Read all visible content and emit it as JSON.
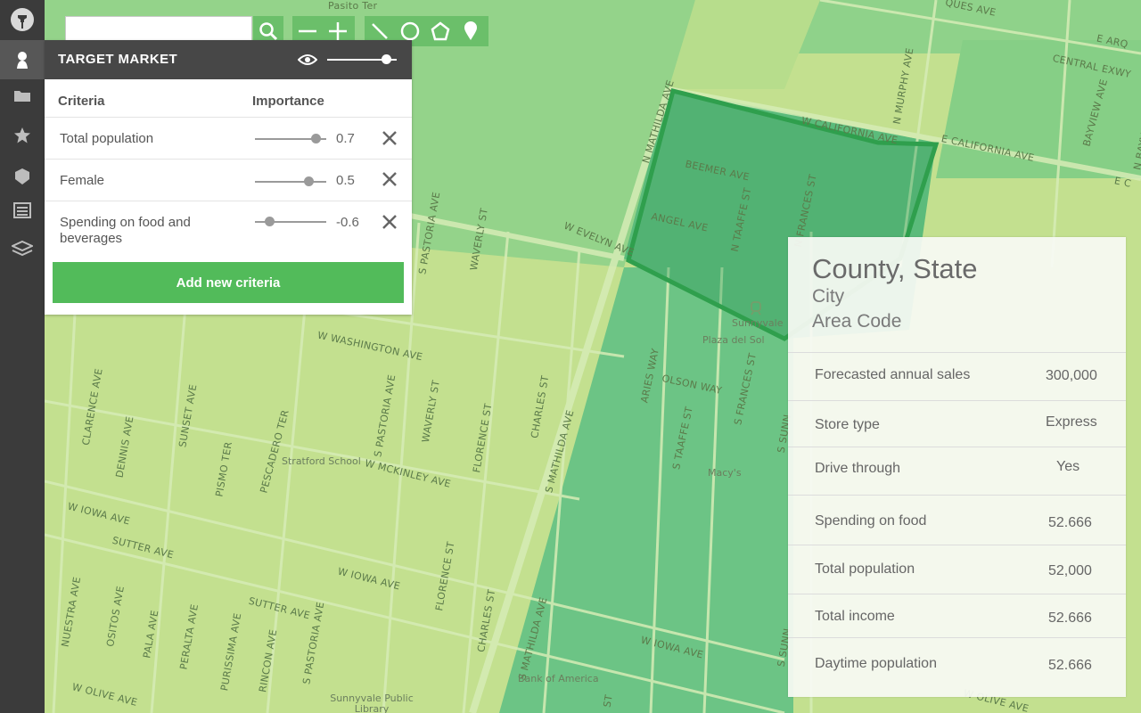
{
  "sidebar": {
    "items": [
      {
        "icon": "pin-icon"
      },
      {
        "icon": "user-icon"
      },
      {
        "icon": "folder-icon"
      },
      {
        "icon": "star-icon"
      },
      {
        "icon": "tag-icon"
      },
      {
        "icon": "list-icon"
      },
      {
        "icon": "layers-icon"
      }
    ]
  },
  "search": {
    "placeholder": ""
  },
  "toolbar": {
    "tools": [
      "search-icon",
      "minus-icon",
      "plus-icon",
      "line-icon",
      "circle-icon",
      "polygon-icon",
      "marker-icon"
    ]
  },
  "panel": {
    "title": "TARGET MARKET",
    "opacity_level": 0.85,
    "col_criteria": "Criteria",
    "col_importance": "Importance",
    "rows": [
      {
        "label": "Total population",
        "value": "0.7",
        "slider": 0.7
      },
      {
        "label": "Female",
        "value": "0.5",
        "slider": 0.5
      },
      {
        "label": "Spending on food and beverages",
        "value": "-0.6",
        "slider": -0.6
      }
    ],
    "add_label": "Add new criteria"
  },
  "card": {
    "title": "County, State",
    "city": "City",
    "area_code": "Area Code",
    "rows": [
      {
        "label": "Forecasted annual sales",
        "value": "300,000"
      },
      {
        "label": "Store type",
        "value": "Express"
      },
      {
        "label": "Drive through",
        "value": "Yes"
      },
      {
        "label": "Spending on food",
        "value": "52.666"
      },
      {
        "label": "Total population",
        "value": "52,000"
      },
      {
        "label": "Total income",
        "value": "52.666"
      },
      {
        "label": "Daytime population",
        "value": "52.666"
      }
    ]
  },
  "map": {
    "streets": [
      "Pasito Ter",
      "QUES AVE",
      "E ARQ",
      "CENTRAL EXWY",
      "N MURPHY AVE",
      "BAYVIEW AVE",
      "N BAYVIEW AVE",
      "W CALIFORNIA AVE",
      "E CALIFORNIA AVE",
      "E C",
      "N MATHILDA AVE",
      "BEEMER AVE",
      "ANGEL AVE",
      "N TAAFFE ST",
      "N FRANCES ST",
      "W EVELYN AVE",
      "S PASTORIA AVE",
      "WAVERLY ST",
      "W WASHINGTON AVE",
      "CLARENCE AVE",
      "SUNSET AVE",
      "S PASTORIA AVE",
      "WAVERLY ST",
      "FLORENCE ST",
      "CHARLES ST",
      "S MATHILDA AVE",
      "ARIES WAY",
      "OLSON WAY",
      "S FRANCES ST",
      "S TAAFFE ST",
      "DENNIS AVE",
      "PISMO TER",
      "PESCADERO TER",
      "W MCKINLEY AVE",
      "W IOWA AVE",
      "SUTTER AVE",
      "SUTTER AVE",
      "W IOWA AVE",
      "W IOWA AVE",
      "NUESTRA AVE",
      "OSITOS AVE",
      "PALA AVE",
      "PERALTA AVE",
      "PURISSIMA AVE",
      "RINCON AVE",
      "S PASTORIA AVE",
      "FLORENCE ST",
      "CHARLES ST",
      "S MATHILDA AVE",
      "W OLIVE AVE",
      "W OLIVE AVE",
      "S SUNN",
      "S SUNN",
      "ST"
    ],
    "pois": [
      "Sunnyvale",
      "Plaza del Sol",
      "Stratford School",
      "Macy's",
      "Bank of America",
      "Sunnyvale Public Library"
    ],
    "colors": {
      "light": "#c2e08f",
      "mid": "#7fd08c",
      "dark": "#5db879",
      "highlight": "#4aa86a",
      "outline": "#2e9e4c"
    }
  }
}
